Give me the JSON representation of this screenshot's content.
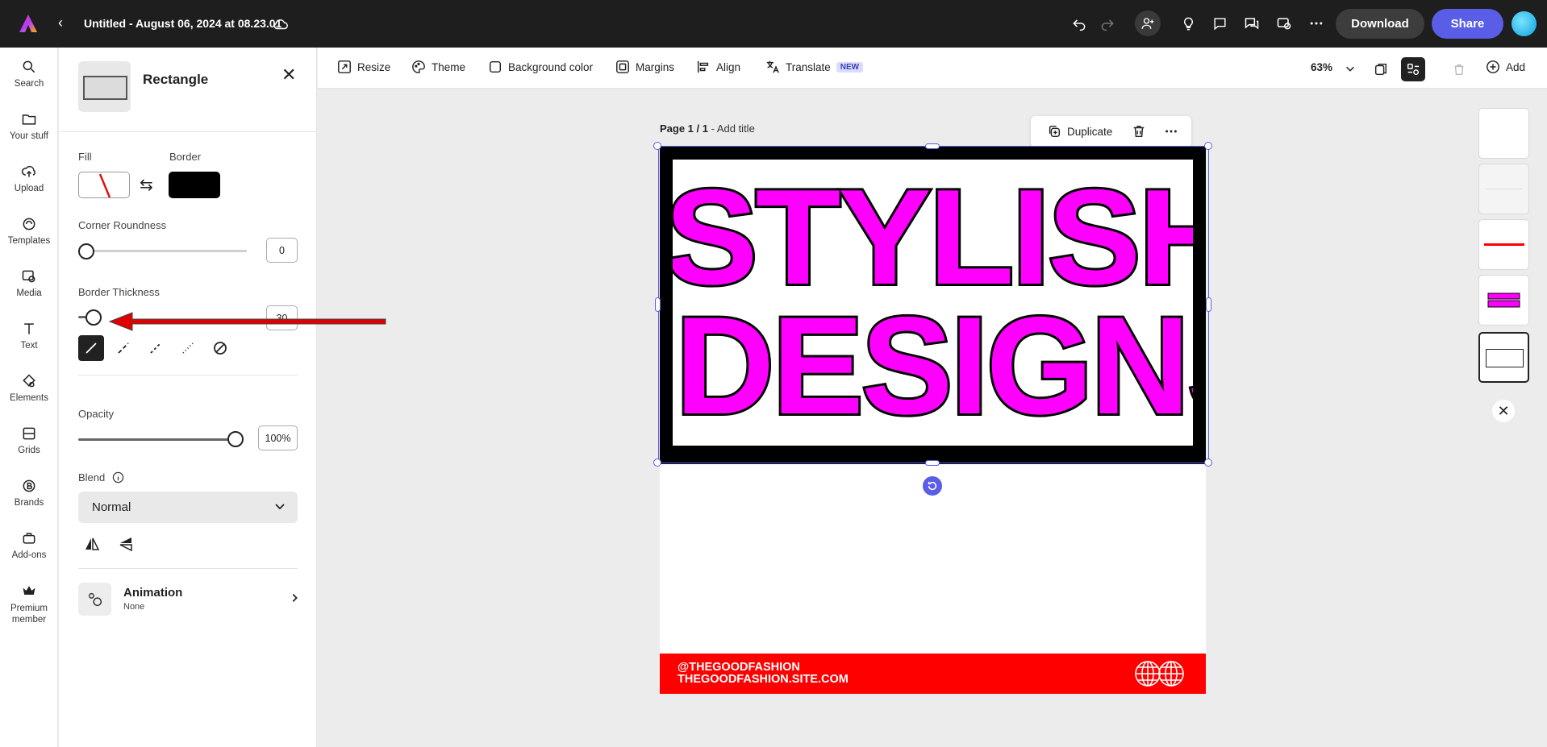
{
  "topbar": {
    "doc_title": "Untitled - August 06, 2024 at 08.23.01",
    "download_label": "Download",
    "share_label": "Share"
  },
  "rail": [
    {
      "label": "Search",
      "icon": "search-icon"
    },
    {
      "label": "Your stuff",
      "icon": "folder-icon"
    },
    {
      "label": "Upload",
      "icon": "upload-icon"
    },
    {
      "label": "Templates",
      "icon": "templates-icon"
    },
    {
      "label": "Media",
      "icon": "media-icon"
    },
    {
      "label": "Text",
      "icon": "text-icon"
    },
    {
      "label": "Elements",
      "icon": "elements-icon"
    },
    {
      "label": "Grids",
      "icon": "grids-icon"
    },
    {
      "label": "Brands",
      "icon": "brands-icon"
    },
    {
      "label": "Add-ons",
      "icon": "addons-icon"
    },
    {
      "label": "Premium member",
      "icon": "crown-icon"
    }
  ],
  "panel": {
    "title": "Rectangle",
    "fill_label": "Fill",
    "border_label": "Border",
    "border_color": "#000000",
    "corner_label": "Corner Roundness",
    "corner_value": "0",
    "thickness_label": "Border Thickness",
    "thickness_value": "30",
    "opacity_label": "Opacity",
    "opacity_value": "100%",
    "blend_label": "Blend",
    "blend_value": "Normal",
    "animation_title": "Animation",
    "animation_value": "None"
  },
  "toolbar": {
    "resize": "Resize",
    "theme": "Theme",
    "background": "Background color",
    "margins": "Margins",
    "align": "Align",
    "translate": "Translate",
    "new_badge": "NEW",
    "zoom": "63%",
    "add": "Add"
  },
  "canvas": {
    "page_label": "Page 1 / 1",
    "add_title": "Add title",
    "duplicate": "Duplicate",
    "headline_1": "STYLISH",
    "headline_2": "DESIGNS",
    "footer_line_1": "@THEGOODFASHION",
    "footer_line_2": "THEGOODFASHION.SITE.COM",
    "accent_magenta": "#ff00ff",
    "accent_red": "#ff0000",
    "selection_color": "#5a5ee6"
  }
}
